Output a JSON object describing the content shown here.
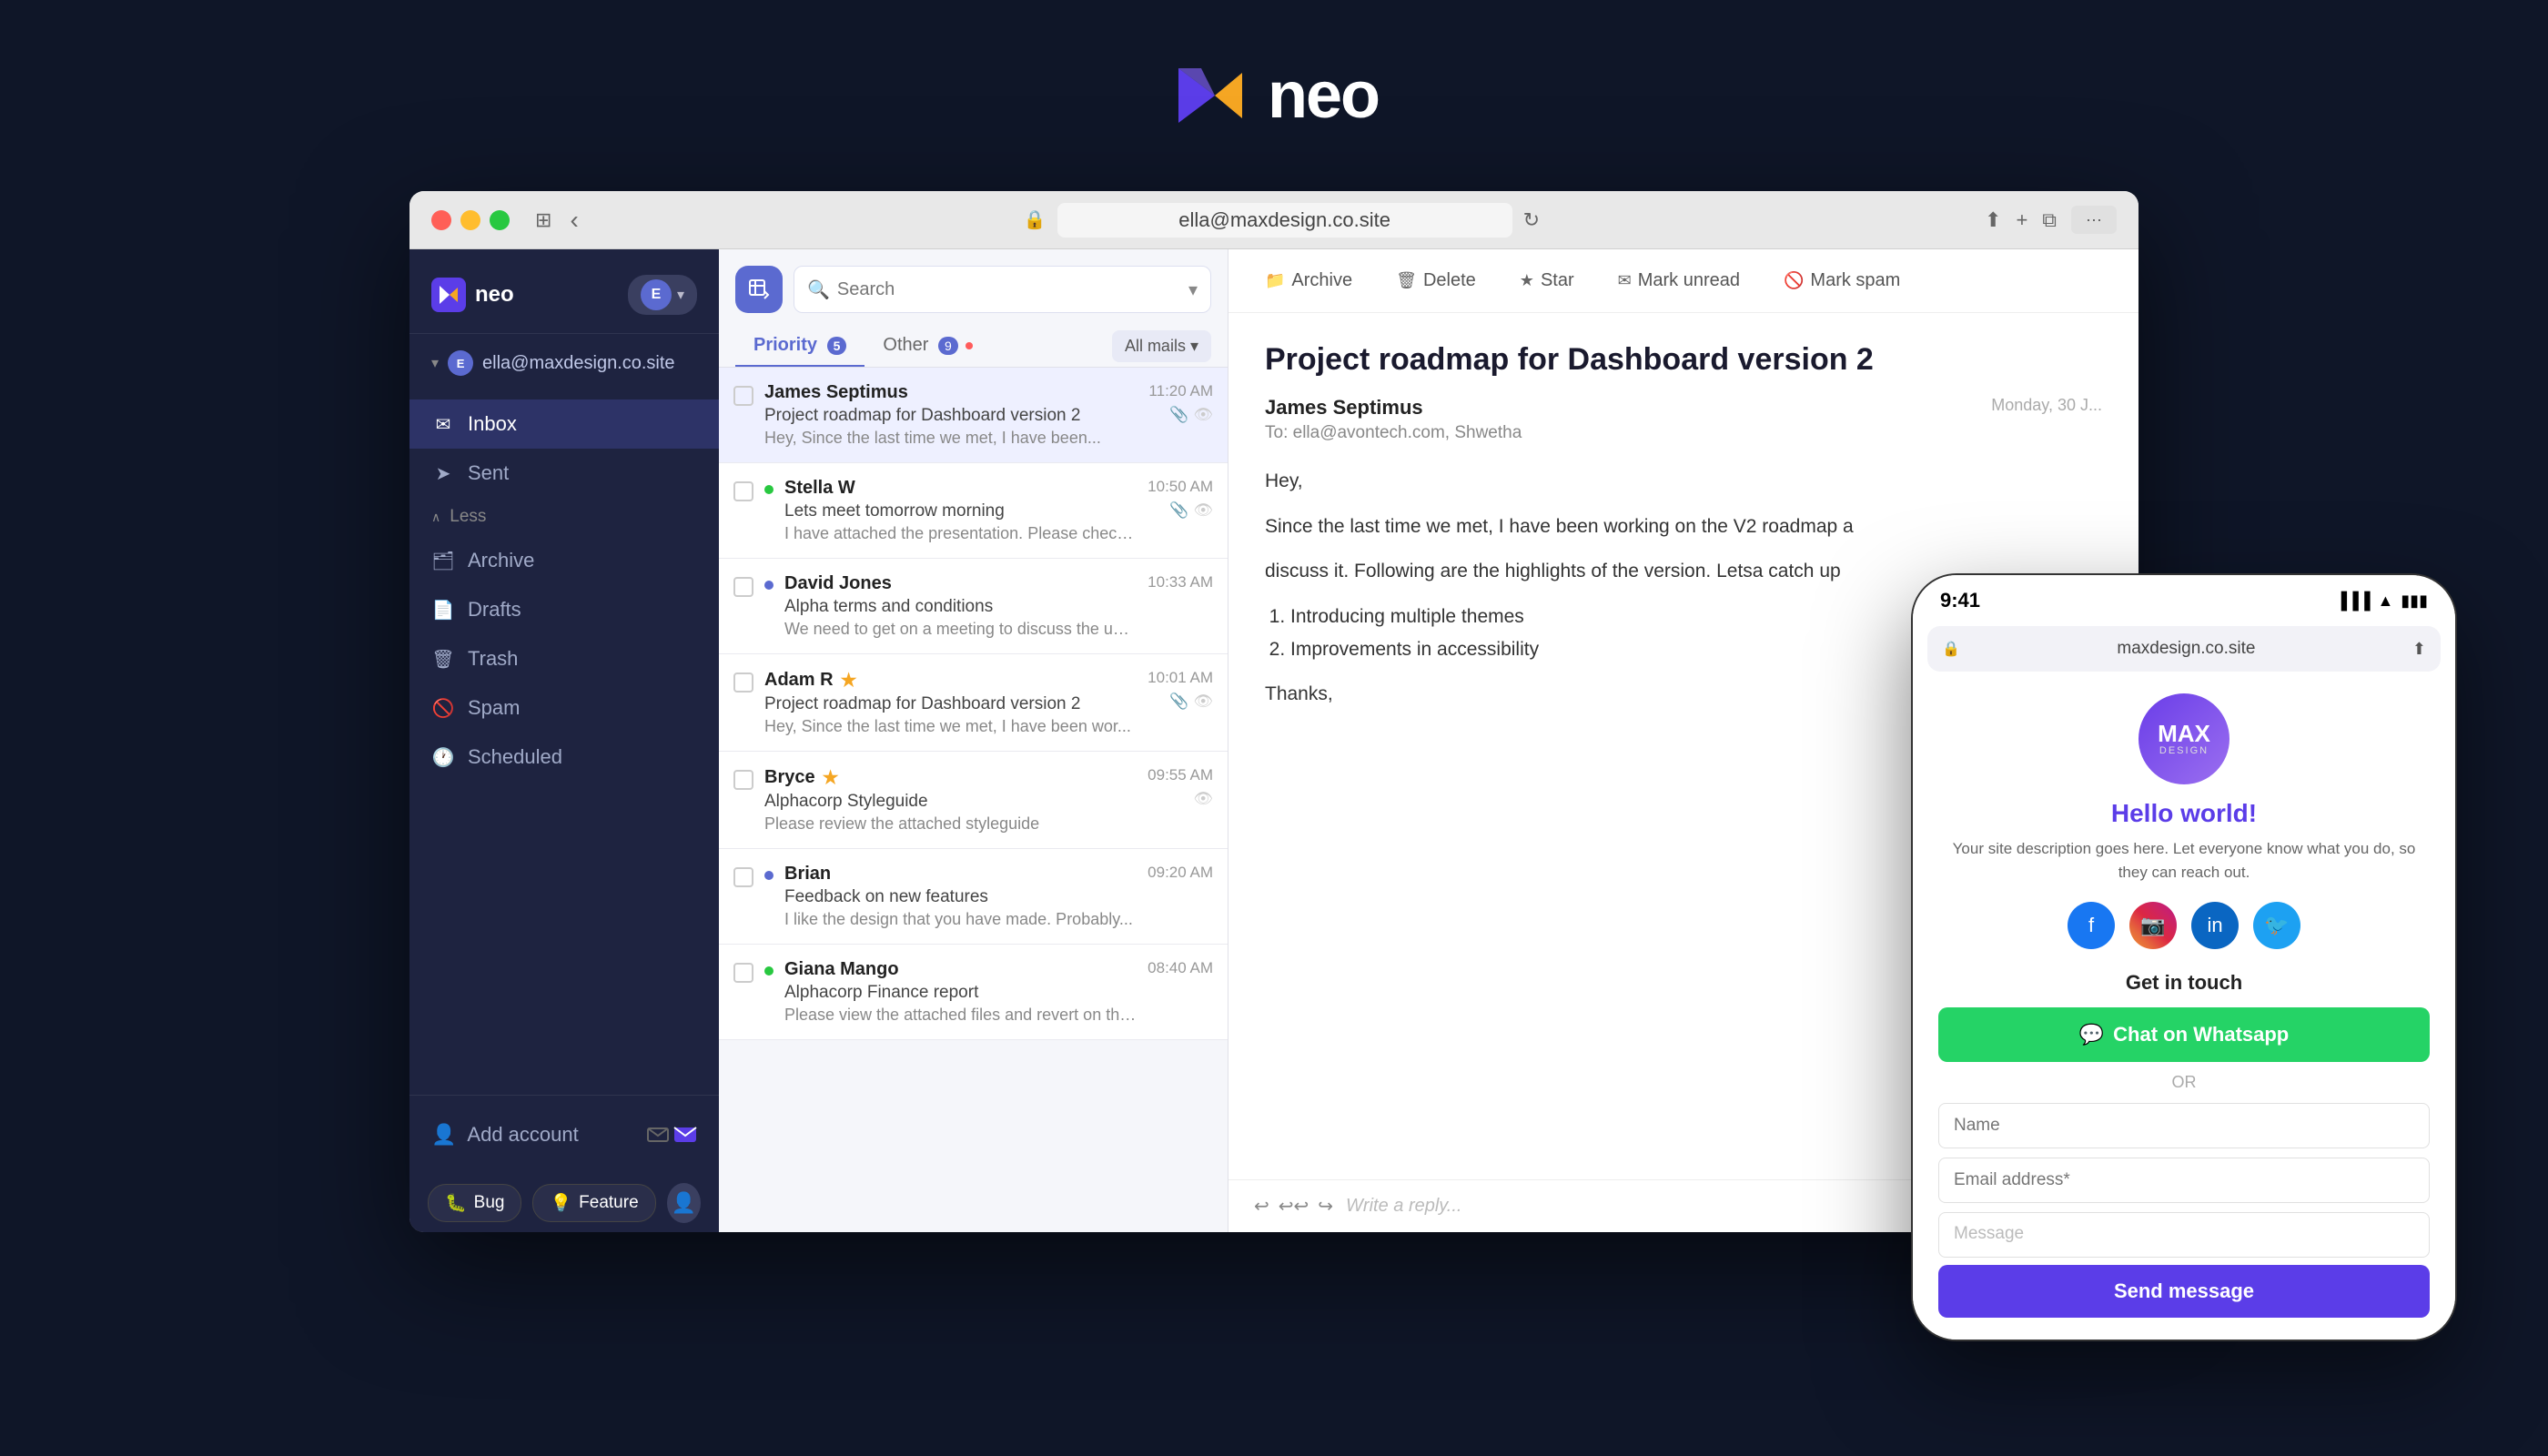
{
  "header": {
    "logo_text": "neo"
  },
  "browser": {
    "url": "ella@maxdesign.co.site",
    "reload_icon": "↻",
    "share_icon": "↑",
    "add_tab_icon": "+",
    "copy_icon": "⧉",
    "back_icon": "‹"
  },
  "sidebar": {
    "logo_text": "neo",
    "account_email": "ella@maxdesign.co.site",
    "nav_items": [
      {
        "label": "Inbox",
        "icon": "✉",
        "active": true
      },
      {
        "label": "Sent",
        "icon": "➤",
        "active": false
      },
      {
        "label": "Less",
        "icon": "∧",
        "type": "toggle"
      },
      {
        "label": "Archive",
        "icon": "🗂",
        "active": false
      },
      {
        "label": "Drafts",
        "icon": "📄",
        "active": false
      },
      {
        "label": "Trash",
        "icon": "🗑",
        "active": false
      },
      {
        "label": "Spam",
        "icon": "🚫",
        "active": false
      },
      {
        "label": "Scheduled",
        "icon": "🕐",
        "active": false
      }
    ],
    "add_account_label": "Add account"
  },
  "email_list": {
    "search_placeholder": "Search",
    "tab_priority": "Priority",
    "tab_priority_count": "5",
    "tab_other": "Other",
    "tab_other_count": "9",
    "all_mails_label": "All mails",
    "emails": [
      {
        "from": "James Septimus",
        "subject": "Project roadmap for Dashboard version 2",
        "preview": "Hey, Since the last time we met, I have been...",
        "time": "11:20 AM",
        "active": true,
        "has_icons": true,
        "star": false,
        "unread": false
      },
      {
        "from": "Stella W",
        "subject": "Lets meet tomorrow morning",
        "preview": "I have attached the presentation. Please check and I...",
        "time": "10:50 AM",
        "active": false,
        "has_icons": true,
        "star": false,
        "unread_green": true
      },
      {
        "from": "David Jones",
        "subject": "Alpha terms and conditions",
        "preview": "We need to get on a meeting to discuss the updated ter...",
        "time": "10:33 AM",
        "active": false,
        "has_icons": false,
        "star": false,
        "unread_blue": true
      },
      {
        "from": "Adam R",
        "subject": "Project roadmap for Dashboard version 2",
        "preview": "Hey, Since the last time we met, I have been wor...",
        "time": "10:01 AM",
        "active": false,
        "has_icons": true,
        "star": true,
        "unread": false
      },
      {
        "from": "Bryce",
        "subject": "Alphacorp Styleguide",
        "preview": "Please review the attached styleguide",
        "time": "09:55 AM",
        "active": false,
        "has_icons": true,
        "star": true,
        "unread": false
      },
      {
        "from": "Brian",
        "subject": "Feedback on new features",
        "preview": "I like the design that you have made. Probably...",
        "time": "09:20 AM",
        "active": false,
        "has_icons": false,
        "star": false,
        "unread_blue": true
      },
      {
        "from": "Giana Mango",
        "subject": "Alphacorp Finance report",
        "preview": "Please view the attached files and revert on the...",
        "time": "08:40 AM",
        "active": false,
        "has_icons": false,
        "star": false,
        "unread_green": true
      }
    ]
  },
  "email_detail": {
    "toolbar": {
      "archive": "Archive",
      "delete": "Delete",
      "star": "Star",
      "mark_unread": "Mark unread",
      "mark_spam": "Mark spam"
    },
    "subject": "Project roadmap for Dashboard version 2",
    "from": "James Septimus",
    "to": "To: ella@avontech.com, Shwetha",
    "date": "Monday, 30 J...",
    "greeting": "Hey,",
    "body_line1": "Since the last time we met, I have been working on the V2 roadmap a",
    "body_line2": "discuss it. Following are the highlights of the version. Letsa catch up",
    "body_list": [
      "1. Introducing multiple themes",
      "2. Improvements in accessibility"
    ],
    "thanks": "Thanks,",
    "reply_placeholder": "Write a reply..."
  },
  "mobile": {
    "time": "9:41",
    "url": "maxdesign.co.site",
    "app_logo_letters": "MAX",
    "hello_text": "Hello world!",
    "description": "Your site description goes here. Let everyone know what you do, so they can reach out.",
    "get_in_touch": "Get in touch",
    "whatsapp_btn": "Chat on Whatsapp",
    "or": "OR",
    "form_name_placeholder": "Name",
    "form_email_placeholder": "Email address*",
    "form_message_placeholder": "Message",
    "send_btn": "Send message"
  },
  "bottom_toolbar": {
    "bug_label": "Bug",
    "feature_label": "Feature"
  }
}
